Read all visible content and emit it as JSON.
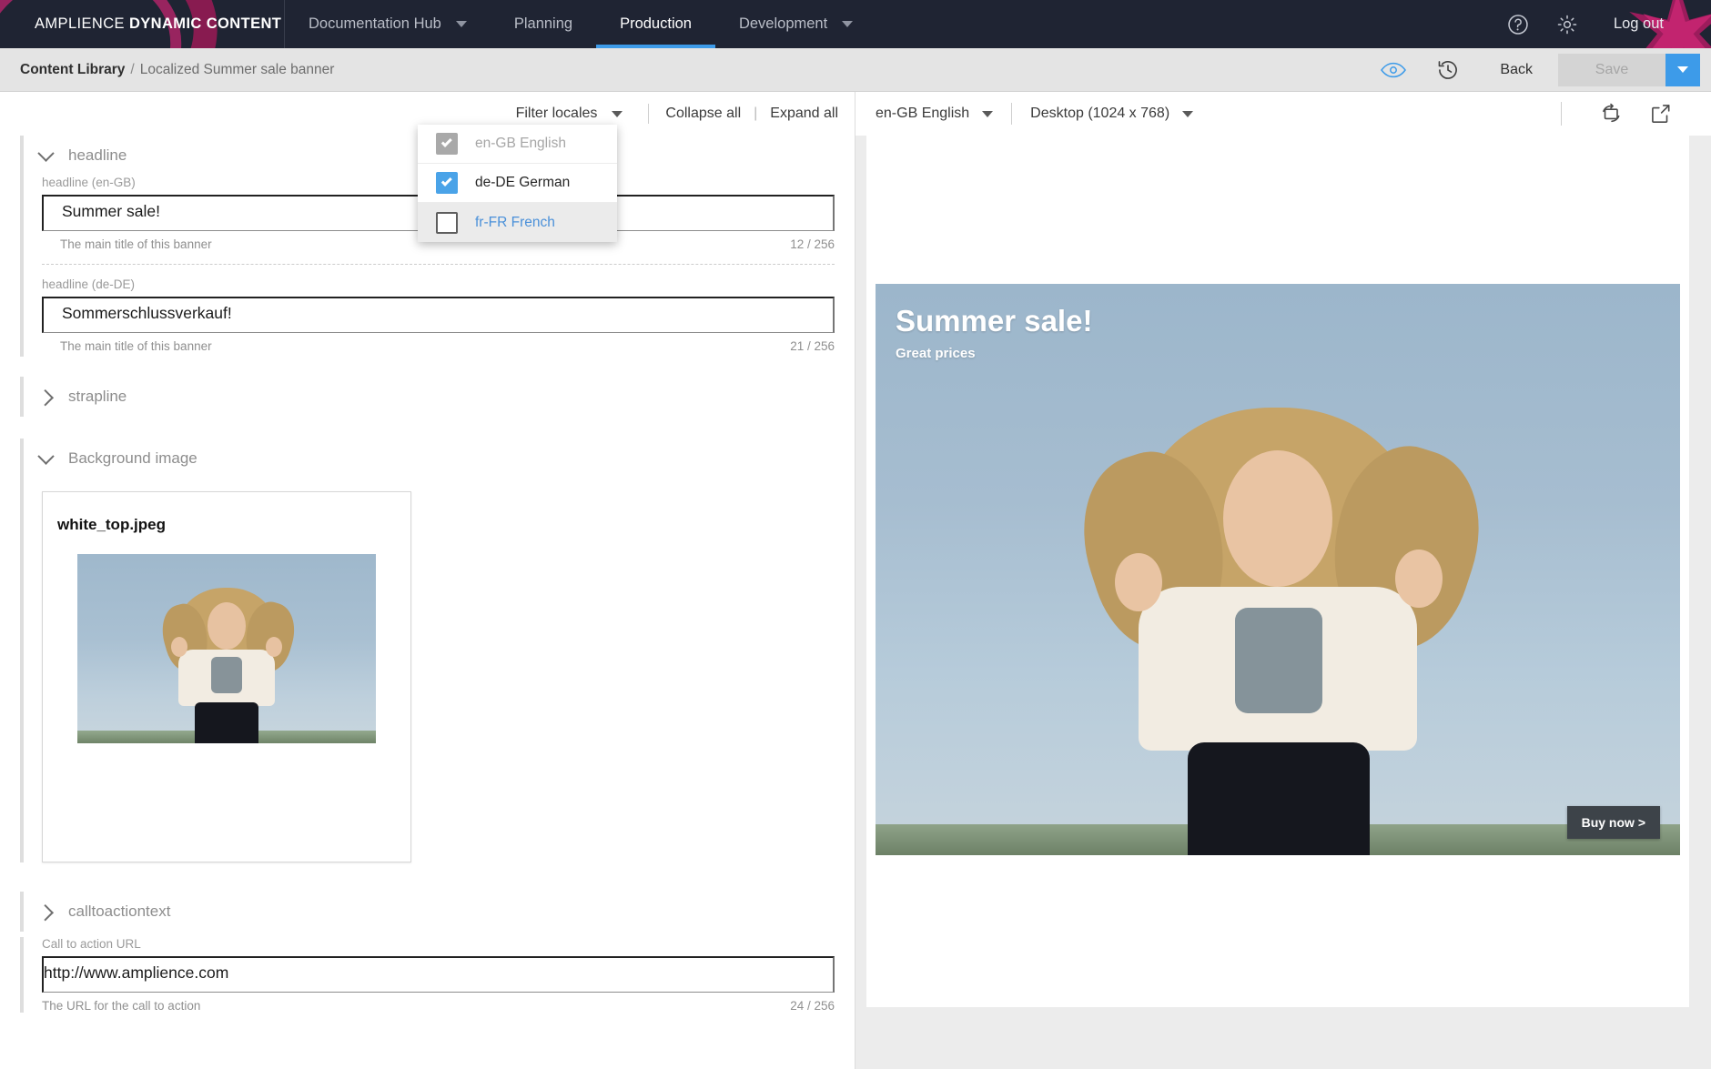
{
  "topbar": {
    "brand_light": "AMPLIENCE ",
    "brand_bold": "DYNAMIC CONTENT",
    "nav": [
      {
        "label": "Documentation Hub",
        "caret": true,
        "active": false
      },
      {
        "label": "Planning",
        "caret": false,
        "active": false
      },
      {
        "label": "Production",
        "caret": false,
        "active": true
      },
      {
        "label": "Development",
        "caret": true,
        "active": false
      }
    ],
    "help_icon": "help-circle-icon",
    "settings_icon": "gear-icon",
    "logout_label": "Log out",
    "accent_color": "#3d9be9",
    "background_color": "#1f2433"
  },
  "subheader": {
    "breadcrumb_root": "Content Library",
    "breadcrumb_separator": "/",
    "breadcrumb_leaf": "Localized Summer sale banner",
    "preview_icon": "eye-icon",
    "history_icon": "history-clock-icon",
    "back_label": "Back",
    "save_label": "Save",
    "save_enabled": false,
    "save_dropdown_icon": "chevron-down-icon"
  },
  "editor_toolbar": {
    "filter_locales_label": "Filter locales",
    "collapse_all_label": "Collapse all",
    "separator": "|",
    "expand_all_label": "Expand all"
  },
  "locale_menu": {
    "open": true,
    "items": [
      {
        "label": "en-GB English",
        "state": "checked-disabled"
      },
      {
        "label": "de-DE German",
        "state": "checked"
      },
      {
        "label": "fr-FR French",
        "state": "empty"
      }
    ]
  },
  "form": {
    "sections": [
      {
        "name": "headline",
        "title": "headline",
        "expanded": true,
        "fields": [
          {
            "label": "headline (en-GB)",
            "value": "Summer sale!",
            "help": "The main title of this banner",
            "counter": "12 / 256"
          },
          {
            "label": "headline (de-DE)",
            "value": "Sommerschlussverkauf!",
            "help": "The main title of this banner",
            "counter": "21 / 256"
          }
        ]
      },
      {
        "name": "strapline",
        "title": "strapline",
        "expanded": false,
        "fields": []
      },
      {
        "name": "background-image",
        "title": "Background image",
        "expanded": true,
        "image_card": {
          "filename": "white_top.jpeg"
        }
      },
      {
        "name": "calltoactiontext",
        "title": "calltoactiontext",
        "expanded": false,
        "fields": []
      }
    ],
    "cta_url_field": {
      "label": "Call to action URL",
      "value": "http://www.amplience.com",
      "help": "The URL for the call to action",
      "counter": "24 / 256"
    }
  },
  "preview": {
    "locale_selected": "en-GB English",
    "device_selected": "Desktop (1024 x 768)",
    "rotate_icon": "rotate-device-icon",
    "open_new_icon": "open-external-icon",
    "banner": {
      "headline": "Summer sale!",
      "strapline": "Great prices",
      "cta_label": "Buy now >"
    }
  }
}
